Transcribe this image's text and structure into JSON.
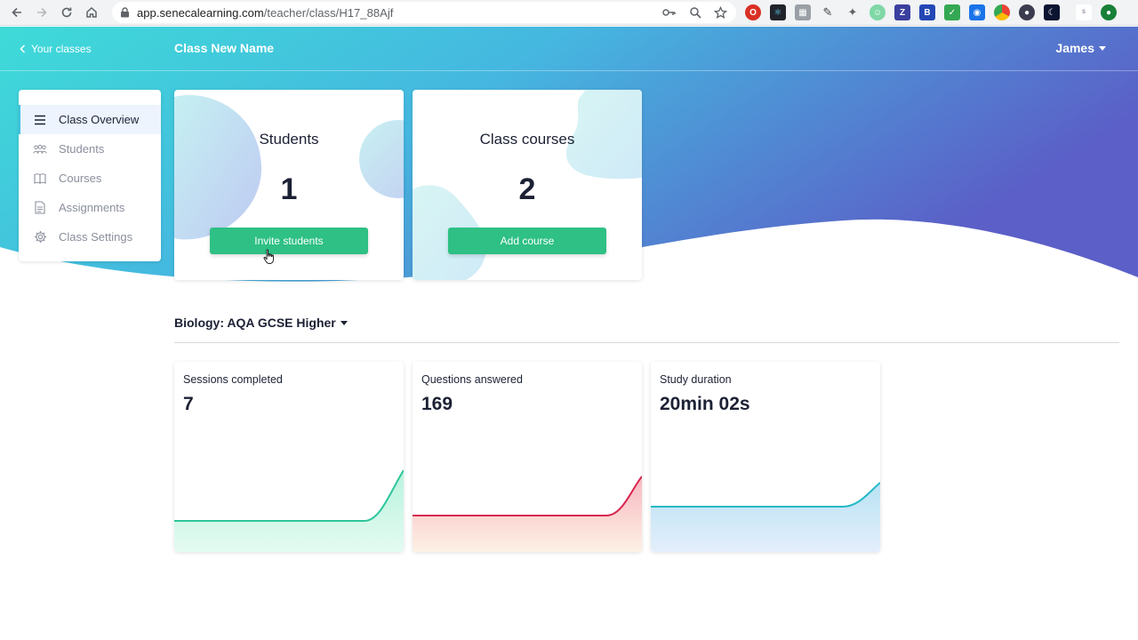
{
  "browser": {
    "url_host": "app.senecalearning.com",
    "url_path": "/teacher/class/H17_88Ajf"
  },
  "header": {
    "back_label": "Your classes",
    "class_name": "Class New Name",
    "user_name": "James"
  },
  "sidebar": {
    "items": [
      {
        "label": "Class Overview",
        "icon": "list-icon",
        "active": true
      },
      {
        "label": "Students",
        "icon": "people-icon",
        "active": false
      },
      {
        "label": "Courses",
        "icon": "book-icon",
        "active": false
      },
      {
        "label": "Assignments",
        "icon": "document-icon",
        "active": false
      },
      {
        "label": "Class Settings",
        "icon": "gear-icon",
        "active": false
      }
    ]
  },
  "cards": {
    "students": {
      "title": "Students",
      "count": "1",
      "button": "Invite students"
    },
    "courses": {
      "title": "Class courses",
      "count": "2",
      "button": "Add course"
    }
  },
  "course_selector": {
    "selected": "Biology: AQA GCSE Higher"
  },
  "metrics": [
    {
      "label": "Sessions completed",
      "value": "7",
      "color": "#2dc69a"
    },
    {
      "label": "Questions answered",
      "value": "169",
      "color": "#d8264f"
    },
    {
      "label": "Study duration",
      "value": "20min 02s",
      "color": "#25b9c6"
    }
  ],
  "colors": {
    "accent_green": "#2ec085",
    "header_start": "#3edbd8",
    "header_end": "#5b5fc7"
  }
}
